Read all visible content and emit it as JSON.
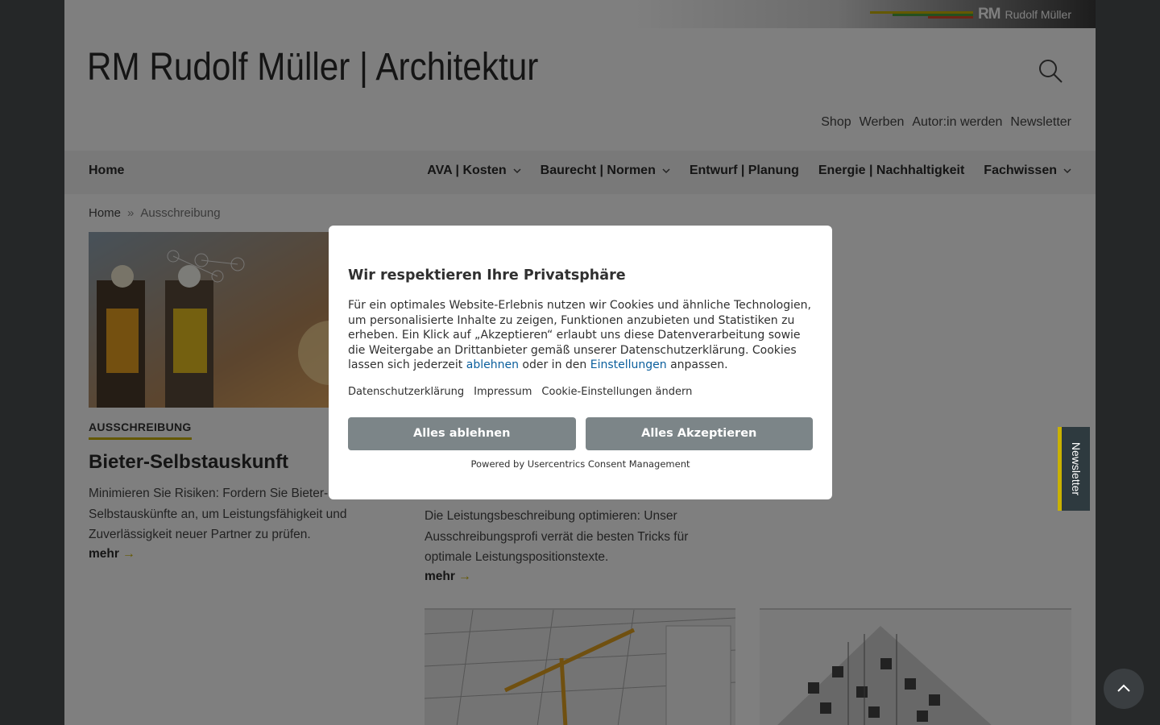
{
  "topbar": {
    "brand_mark": "RM",
    "brand_name": "Rudolf Müller"
  },
  "header": {
    "site_title": "RM Rudolf Müller | Architektur",
    "search_icon": "search-icon",
    "links": [
      "Shop",
      "Werben",
      "Autor:in werden",
      "Newsletter"
    ]
  },
  "nav": {
    "home": "Home",
    "items": [
      {
        "label": "AVA | Kosten",
        "has_dropdown": true
      },
      {
        "label": "Baurecht | Normen",
        "has_dropdown": true
      },
      {
        "label": "Entwurf | Planung",
        "has_dropdown": false
      },
      {
        "label": "Energie | Nachhaltigkeit",
        "has_dropdown": false
      },
      {
        "label": "Fachwissen",
        "has_dropdown": true
      }
    ]
  },
  "breadcrumb": {
    "home": "Home",
    "separator": "»",
    "current": "Ausschreibung"
  },
  "articles": [
    {
      "category": "AUSSCHREIBUNG",
      "title": "Bieter-Selbstauskunft",
      "text": "Minimieren Sie Risiken: Fordern Sie Bieter-Selbstauskünfte an, um Leistungsfähigkeit und Zuverlässigkeit neuer Partner zu prüfen.",
      "more": "mehr"
    },
    {
      "text": "Die Leistungsbeschreibung optimieren: Unser Ausschreibungsprofi verrät die besten Tricks für optimale Leistungspositionstexte.",
      "more": "mehr"
    }
  ],
  "newsletter_tab": "Newsletter",
  "consent": {
    "title": "Wir respektieren Ihre Privatsphäre",
    "message_part1": "Für ein optimales Website-Erlebnis nutzen wir Cookies und ähnliche Technologien, um personalisierte Inhalte zu zeigen, Funktionen anzubieten und Statistiken zu erheben. Ein Klick auf „Akzeptieren“ erlaubt uns diese Datenverarbeitung sowie die Weitergabe an Drittanbieter gemäß unserer Datenschutzerklärung. Cookies lassen sich jederzeit ",
    "link_reject": "ablehnen",
    "message_part2": " oder in den ",
    "link_settings": "Einstellungen",
    "message_part3": " anpassen.",
    "footer_links": [
      "Datenschutzerklärung",
      "Impressum",
      "Cookie-Einstellungen ändern"
    ],
    "reject_all": "Alles ablehnen",
    "accept_all": "Alles Akzeptieren",
    "powered_by": "Powered by Usercentrics Consent Management"
  },
  "colors": {
    "accent": "#c9b100",
    "button": "#7c8588",
    "link": "#0a5e9c",
    "dark": "#2e3a3f"
  }
}
